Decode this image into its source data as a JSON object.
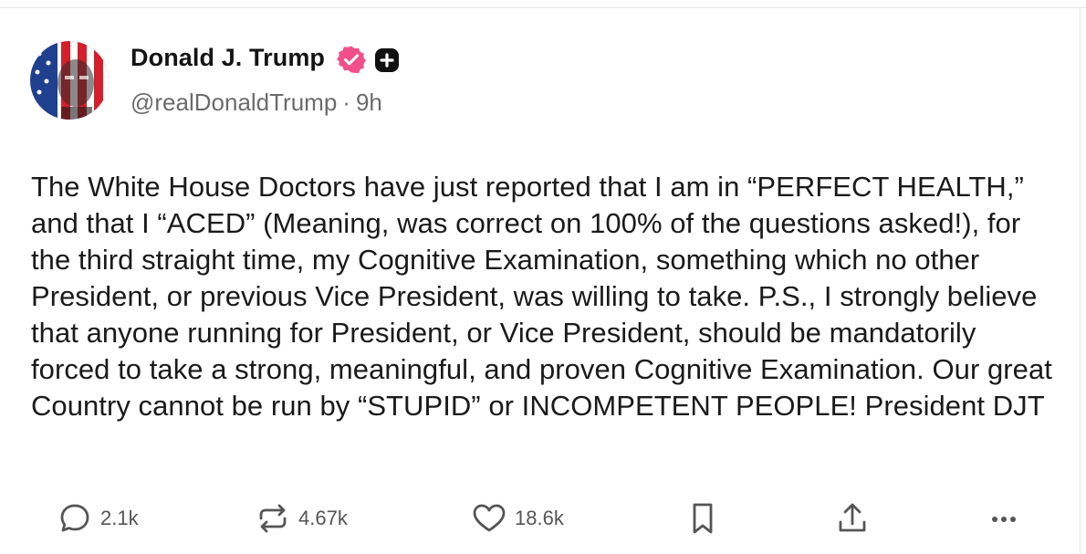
{
  "author": {
    "display_name": "Donald J. Trump",
    "handle": "@realDonaldTrump",
    "separator": "·",
    "time_ago": "9h",
    "badge_color": "#f0508a"
  },
  "post": {
    "text": "The White House Doctors have just reported that I am in “PERFECT HEALTH,” and that I “ACED” (Meaning, was correct on 100% of the questions asked!), for the third straight time, my Cognitive Examination, something which no other President, or previous Vice President, was willing to take. P.S., I strongly believe that anyone running for President, or Vice President, should be mandatorily forced to take a strong, meaningful, and proven Cognitive Examination. Our great Country cannot be run by “STUPID” or INCOMPETENT PEOPLE! President DJT"
  },
  "actions": {
    "replies": "2.1k",
    "retruths": "4.67k",
    "likes": "18.6k"
  },
  "icons": {
    "verified": "verified-badge-icon",
    "plus": "plus-badge-icon",
    "reply": "reply-icon",
    "retruth": "retruth-icon",
    "like": "heart-icon",
    "bookmark": "bookmark-icon",
    "share": "share-icon",
    "more": "more-icon"
  }
}
